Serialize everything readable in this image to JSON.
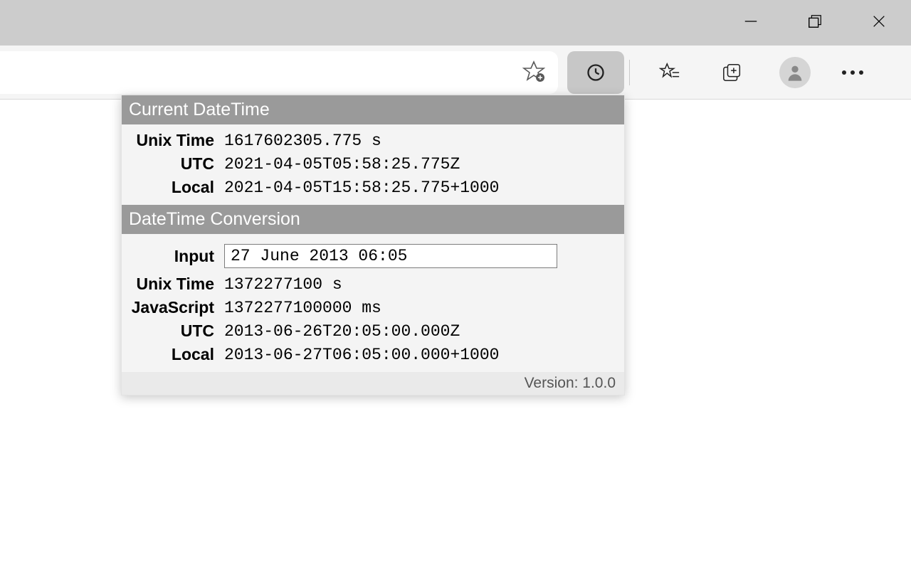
{
  "popup": {
    "section1": {
      "title": "Current DateTime",
      "unix_label": "Unix Time",
      "unix_value": "1617602305.775 s",
      "utc_label": "UTC",
      "utc_value": "2021-04-05T05:58:25.775Z",
      "local_label": "Local",
      "local_value": "2021-04-05T15:58:25.775+1000"
    },
    "section2": {
      "title": "DateTime Conversion",
      "input_label": "Input",
      "input_value": "27 June 2013 06:05",
      "unix_label": "Unix Time",
      "unix_value": "1372277100 s",
      "js_label": "JavaScript",
      "js_value": "1372277100000 ms",
      "utc_label": "UTC",
      "utc_value": "2013-06-26T20:05:00.000Z",
      "local_label": "Local",
      "local_value": "2013-06-27T06:05:00.000+1000"
    },
    "footer": "Version: 1.0.0"
  }
}
